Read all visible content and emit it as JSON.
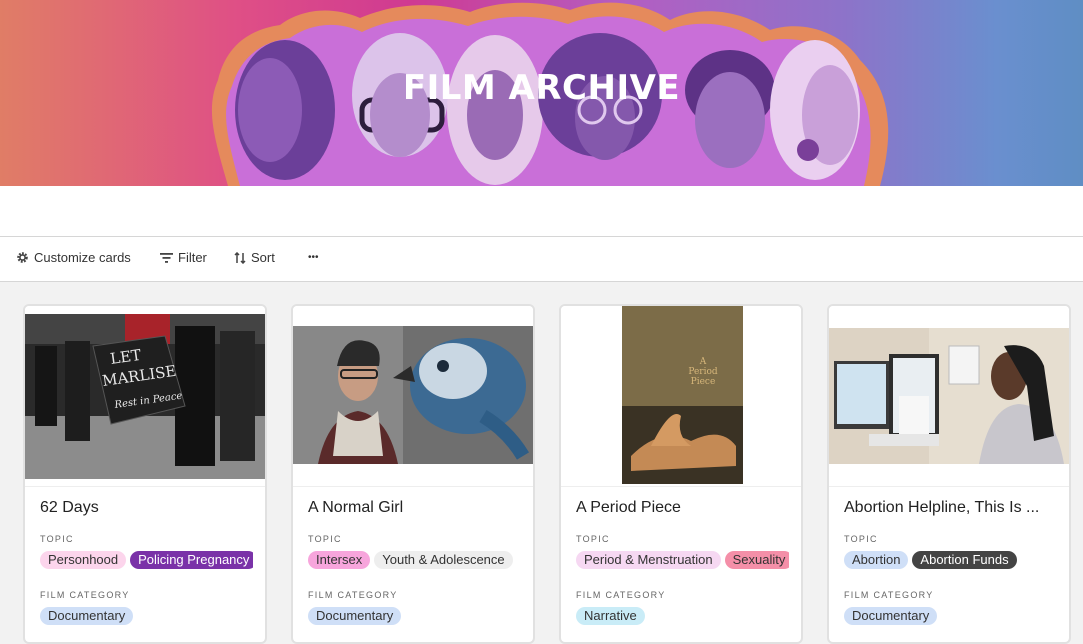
{
  "header": {
    "title": "FILM ARCHIVE"
  },
  "toolbar": {
    "customize_label": "Customize cards",
    "filter_label": "Filter",
    "sort_label": "Sort",
    "more_label": "•••"
  },
  "field_labels": {
    "topic": "TOPIC",
    "category": "FILM CATEGORY"
  },
  "cards": [
    {
      "title": "62 Days",
      "topics": [
        {
          "label": "Personhood",
          "bg": "#fcd5ec",
          "fg": "#333"
        },
        {
          "label": "Policing Pregnancy",
          "bg": "#7a32a8",
          "fg": "#ffffff"
        }
      ],
      "category": {
        "label": "Documentary",
        "bg": "#cfdff7",
        "fg": "#333"
      }
    },
    {
      "title": "A Normal Girl",
      "topics": [
        {
          "label": "Intersex",
          "bg": "#f7a5dc",
          "fg": "#333"
        },
        {
          "label": "Youth & Adolescence",
          "bg": "#eeeeee",
          "fg": "#333"
        }
      ],
      "category": {
        "label": "Documentary",
        "bg": "#cfdff7",
        "fg": "#333"
      }
    },
    {
      "title": "A Period Piece",
      "topics": [
        {
          "label": "Period & Menstruation",
          "bg": "#f6d8f2",
          "fg": "#333"
        },
        {
          "label": "Sexuality",
          "bg": "#f48fa8",
          "fg": "#333"
        }
      ],
      "category": {
        "label": "Narrative",
        "bg": "#c9ecf7",
        "fg": "#333"
      }
    },
    {
      "title": "Abortion Helpline, This Is ...",
      "topics": [
        {
          "label": "Abortion",
          "bg": "#cfdff7",
          "fg": "#333"
        },
        {
          "label": "Abortion Funds",
          "bg": "#444444",
          "fg": "#ffffff"
        }
      ],
      "category": {
        "label": "Documentary",
        "bg": "#cfdff7",
        "fg": "#333"
      }
    }
  ]
}
